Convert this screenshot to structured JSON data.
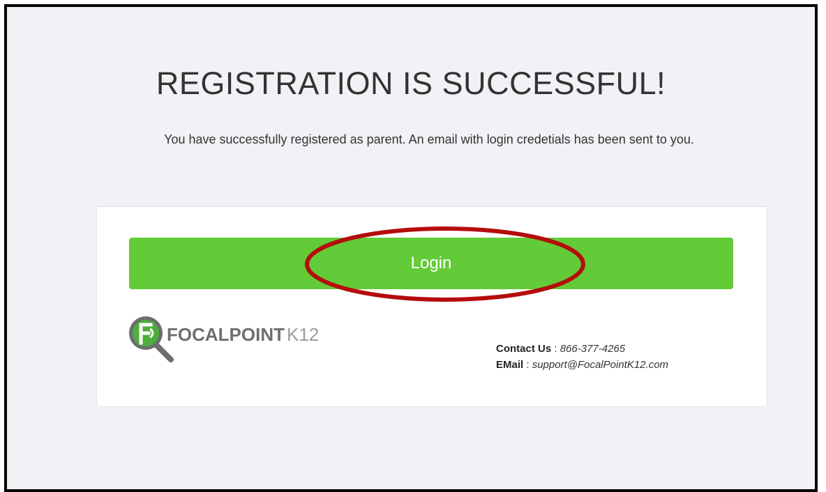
{
  "page": {
    "title": "REGISTRATION IS SUCCESSFUL!",
    "message": "You have successfully registered as parent. An email with login credetials has been sent to you."
  },
  "card": {
    "login_label": "Login",
    "logo": {
      "icon": "focalpoint-magnifier-logo-icon",
      "text_bold": "FOCALPOINT",
      "text_light": "K12"
    },
    "contact": {
      "phone_label": "Contact Us",
      "phone_value": "866-377-4265",
      "email_label": "EMail",
      "email_value": "support@FocalPointK12.com",
      "separator": " : "
    }
  },
  "colors": {
    "background": "#f1f2f5",
    "login_button": "#63cb37",
    "highlight_ellipse": "#b50c0c",
    "logo_green": "#4cae3b",
    "logo_gray": "#6d6e70"
  }
}
